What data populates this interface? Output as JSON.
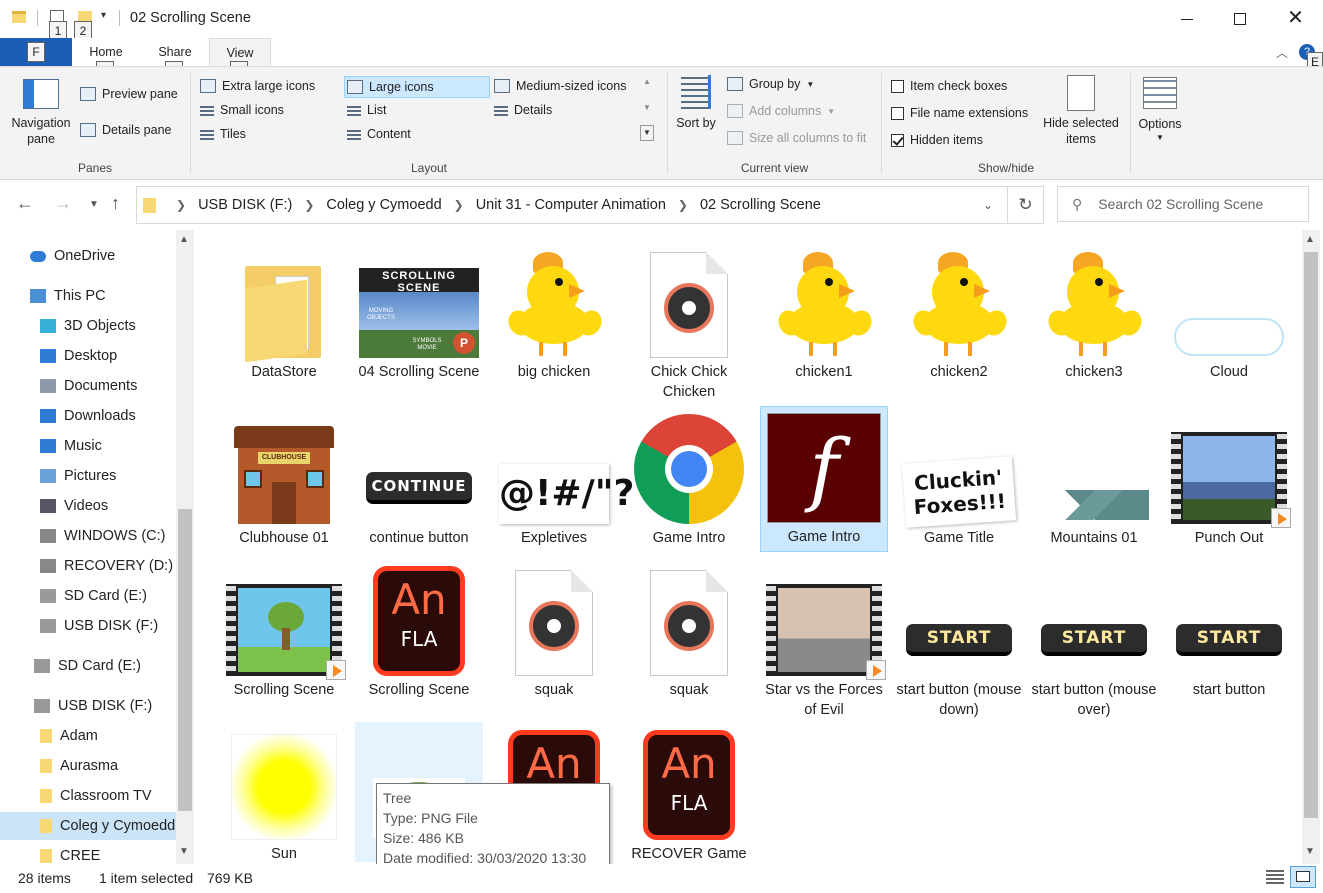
{
  "window": {
    "title": "02 Scrolling Scene",
    "qat_keytips": [
      "1",
      "2"
    ]
  },
  "ribbon": {
    "tabs": [
      {
        "label": "F",
        "keytip": ""
      },
      {
        "label": "Home",
        "keytip": "H"
      },
      {
        "label": "Share",
        "keytip": "S"
      },
      {
        "label": "View",
        "keytip": "V"
      }
    ],
    "help_keytip": "E",
    "panes": {
      "label": "Panes",
      "navigation_pane": "Navigation pane",
      "preview_pane": "Preview pane",
      "details_pane": "Details pane"
    },
    "layout": {
      "label": "Layout",
      "options": [
        "Extra large icons",
        "Large icons",
        "Medium-sized icons",
        "Small icons",
        "List",
        "Details",
        "Tiles",
        "Content"
      ],
      "selected": "Large icons"
    },
    "current_view": {
      "label": "Current view",
      "sort_by": "Sort by",
      "group_by": "Group by",
      "add_columns": "Add columns",
      "size_all_columns": "Size all columns to fit"
    },
    "show_hide": {
      "label": "Show/hide",
      "item_check_boxes": {
        "label": "Item check boxes",
        "checked": false
      },
      "file_name_extensions": {
        "label": "File name extensions",
        "checked": false
      },
      "hidden_items": {
        "label": "Hidden items",
        "checked": true
      },
      "hide_selected": "Hide selected items"
    },
    "options": "Options"
  },
  "address": {
    "crumbs": [
      "USB DISK (F:)",
      "Coleg y Cymoedd",
      "Unit 31 - Computer Animation",
      "02 Scrolling Scene"
    ],
    "search_placeholder": "Search 02 Scrolling Scene"
  },
  "nav": [
    {
      "label": "OneDrive",
      "icon": "cloud-icon"
    },
    {
      "label": "This PC",
      "icon": "computer-icon"
    },
    {
      "label": "3D Objects",
      "icon": "cube-icon"
    },
    {
      "label": "Desktop",
      "icon": "desktop-icon"
    },
    {
      "label": "Documents",
      "icon": "documents-icon"
    },
    {
      "label": "Downloads",
      "icon": "download-icon"
    },
    {
      "label": "Music",
      "icon": "music-icon"
    },
    {
      "label": "Pictures",
      "icon": "pictures-icon"
    },
    {
      "label": "Videos",
      "icon": "videos-icon"
    },
    {
      "label": "WINDOWS (C:)",
      "icon": "drive-icon"
    },
    {
      "label": "RECOVERY (D:)",
      "icon": "drive-icon"
    },
    {
      "label": "SD Card (E:)",
      "icon": "sd-card-icon"
    },
    {
      "label": "USB DISK (F:)",
      "icon": "usb-drive-icon"
    },
    {
      "label": "SD Card (E:)",
      "icon": "sd-card-icon"
    },
    {
      "label": "USB DISK (F:)",
      "icon": "usb-drive-icon"
    },
    {
      "label": "Adam",
      "icon": "folder-icon"
    },
    {
      "label": "Aurasma",
      "icon": "folder-icon"
    },
    {
      "label": "Classroom TV",
      "icon": "folder-icon"
    },
    {
      "label": "Coleg y Cymoedd",
      "icon": "folder-icon"
    },
    {
      "label": "CREE",
      "icon": "folder-icon"
    }
  ],
  "files": [
    {
      "name": "DataStore",
      "kind": "folder"
    },
    {
      "name": "04 Scrolling Scene",
      "kind": "pptx-thumb"
    },
    {
      "name": "big chicken",
      "kind": "chick-angry"
    },
    {
      "name": "Chick Chick Chicken",
      "kind": "audio"
    },
    {
      "name": "chicken1",
      "kind": "chick"
    },
    {
      "name": "chicken2",
      "kind": "chick"
    },
    {
      "name": "chicken3",
      "kind": "chick"
    },
    {
      "name": "Cloud",
      "kind": "cloud"
    },
    {
      "name": "Clubhouse 01",
      "kind": "clubhouse"
    },
    {
      "name": "continue button",
      "kind": "button"
    },
    {
      "name": "Expletives",
      "kind": "expletives"
    },
    {
      "name": "Game Intro",
      "kind": "chrome"
    },
    {
      "name": "Game Intro",
      "kind": "flash"
    },
    {
      "name": "Game Title",
      "kind": "game-title"
    },
    {
      "name": "Mountains 01",
      "kind": "mountains"
    },
    {
      "name": "Punch Out",
      "kind": "video"
    },
    {
      "name": "Scrolling Scene",
      "kind": "video-tree"
    },
    {
      "name": "Scrolling Scene",
      "kind": "fla"
    },
    {
      "name": "squak",
      "kind": "audio"
    },
    {
      "name": "squak",
      "kind": "audio"
    },
    {
      "name": "Star vs the Forces of Evil",
      "kind": "video-cartoon"
    },
    {
      "name": "start button (mouse down)",
      "kind": "button"
    },
    {
      "name": "start button (mouse over)",
      "kind": "button"
    },
    {
      "name": "start button",
      "kind": "button"
    },
    {
      "name": "Sun",
      "kind": "sun"
    },
    {
      "name": "Tree",
      "kind": "tree"
    },
    {
      "name": "",
      "kind": "fla"
    },
    {
      "name": "RECOVER Game",
      "kind": "fla"
    }
  ],
  "image_text": {
    "scrolling_scene_banner": "SCROLLING SCENE",
    "continue_btn": "CONTINUE",
    "start_btn": "START",
    "expletives": "@!#/\"?",
    "game_title": "Cluckin' Foxes!!!",
    "an": "An",
    "fla": "FLA",
    "moving_objects": "MOVING OBJECTS",
    "symbols_movie": "SYMBOLS MOVIE"
  },
  "tooltip": {
    "name": "Tree",
    "type": "Type: PNG File",
    "size": "Size: 486 KB",
    "modified": "Date modified: 30/03/2020 13:30"
  },
  "status": {
    "items": "28 items",
    "selection": "1 item selected",
    "size": "769 KB"
  },
  "colors": {
    "accent": "#1a5fb4",
    "selection": "#cce8ff",
    "selection_border": "#99d1ff",
    "folder": "#f8d775"
  }
}
